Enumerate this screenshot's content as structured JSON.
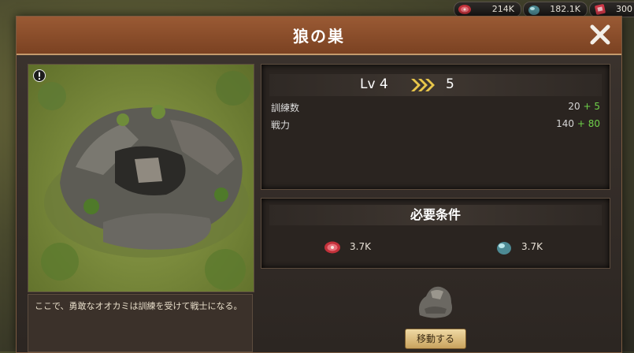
{
  "resources": [
    {
      "icon": "meat-icon",
      "value": "214K"
    },
    {
      "icon": "water-drop-icon",
      "value": "182.1K"
    },
    {
      "icon": "gem-icon",
      "value": "300"
    }
  ],
  "dialog": {
    "title": "狼の巣",
    "close_icon": "close-icon"
  },
  "building": {
    "alert_icon": "alert-icon",
    "description": "ここで、勇敢なオオカミは訓練を受けて戦士になる。"
  },
  "level": {
    "current": "Lv 4",
    "next": "5",
    "stats": [
      {
        "label": "訓練数",
        "base": "20",
        "plus": "+ 5"
      },
      {
        "label": "戦力",
        "base": "140",
        "plus": "+ 80"
      }
    ]
  },
  "requirements": {
    "title": "必要条件",
    "items": [
      {
        "icon": "meat-icon",
        "value": "3.7K"
      },
      {
        "icon": "water-drop-icon",
        "value": "3.7K"
      }
    ]
  },
  "move": {
    "label": "移動する",
    "icon": "stone-icon"
  },
  "colors": {
    "title_bar": "#8a4e2b",
    "stat_plus": "#6fd24a",
    "button": "#d9b978"
  }
}
